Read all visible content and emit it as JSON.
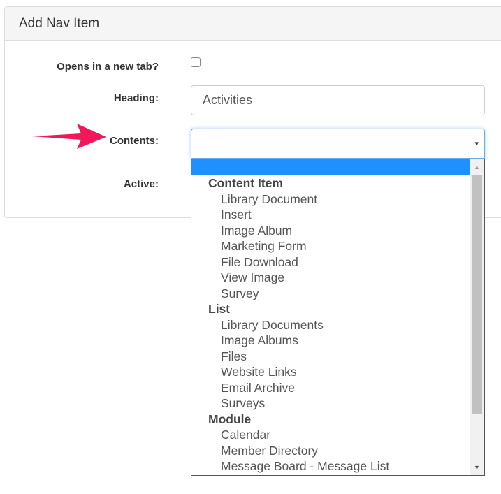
{
  "dialog": {
    "title": "Add Nav Item"
  },
  "form": {
    "new_tab_label": "Opens in a new tab?",
    "new_tab_checked": false,
    "heading_label": "Heading:",
    "heading_value": "Activities",
    "contents_label": "Contents:",
    "contents_value": "",
    "active_label": "Active:"
  },
  "dropdown": {
    "items": [
      {
        "type": "group",
        "label": "Content Item"
      },
      {
        "type": "option",
        "label": "Library Document"
      },
      {
        "type": "option",
        "label": "Insert"
      },
      {
        "type": "option",
        "label": "Image Album"
      },
      {
        "type": "option",
        "label": "Marketing Form"
      },
      {
        "type": "option",
        "label": "File Download"
      },
      {
        "type": "option",
        "label": "View Image"
      },
      {
        "type": "option",
        "label": "Survey"
      },
      {
        "type": "group",
        "label": "List"
      },
      {
        "type": "option",
        "label": "Library Documents"
      },
      {
        "type": "option",
        "label": "Image Albums"
      },
      {
        "type": "option",
        "label": "Files"
      },
      {
        "type": "option",
        "label": "Website Links"
      },
      {
        "type": "option",
        "label": "Email Archive"
      },
      {
        "type": "option",
        "label": "Surveys"
      },
      {
        "type": "group",
        "label": "Module"
      },
      {
        "type": "option",
        "label": "Calendar"
      },
      {
        "type": "option",
        "label": "Member Directory"
      },
      {
        "type": "option",
        "label": "Message Board - Message List"
      }
    ]
  },
  "colors": {
    "highlight": "#1e90ff",
    "focus_border": "#66afe9",
    "arrow": "#f0185a"
  },
  "icons": {
    "select_caret": "▾",
    "scroll_up": "▲",
    "scroll_down": "▼",
    "annotation_arrow": "arrow-right-icon"
  }
}
